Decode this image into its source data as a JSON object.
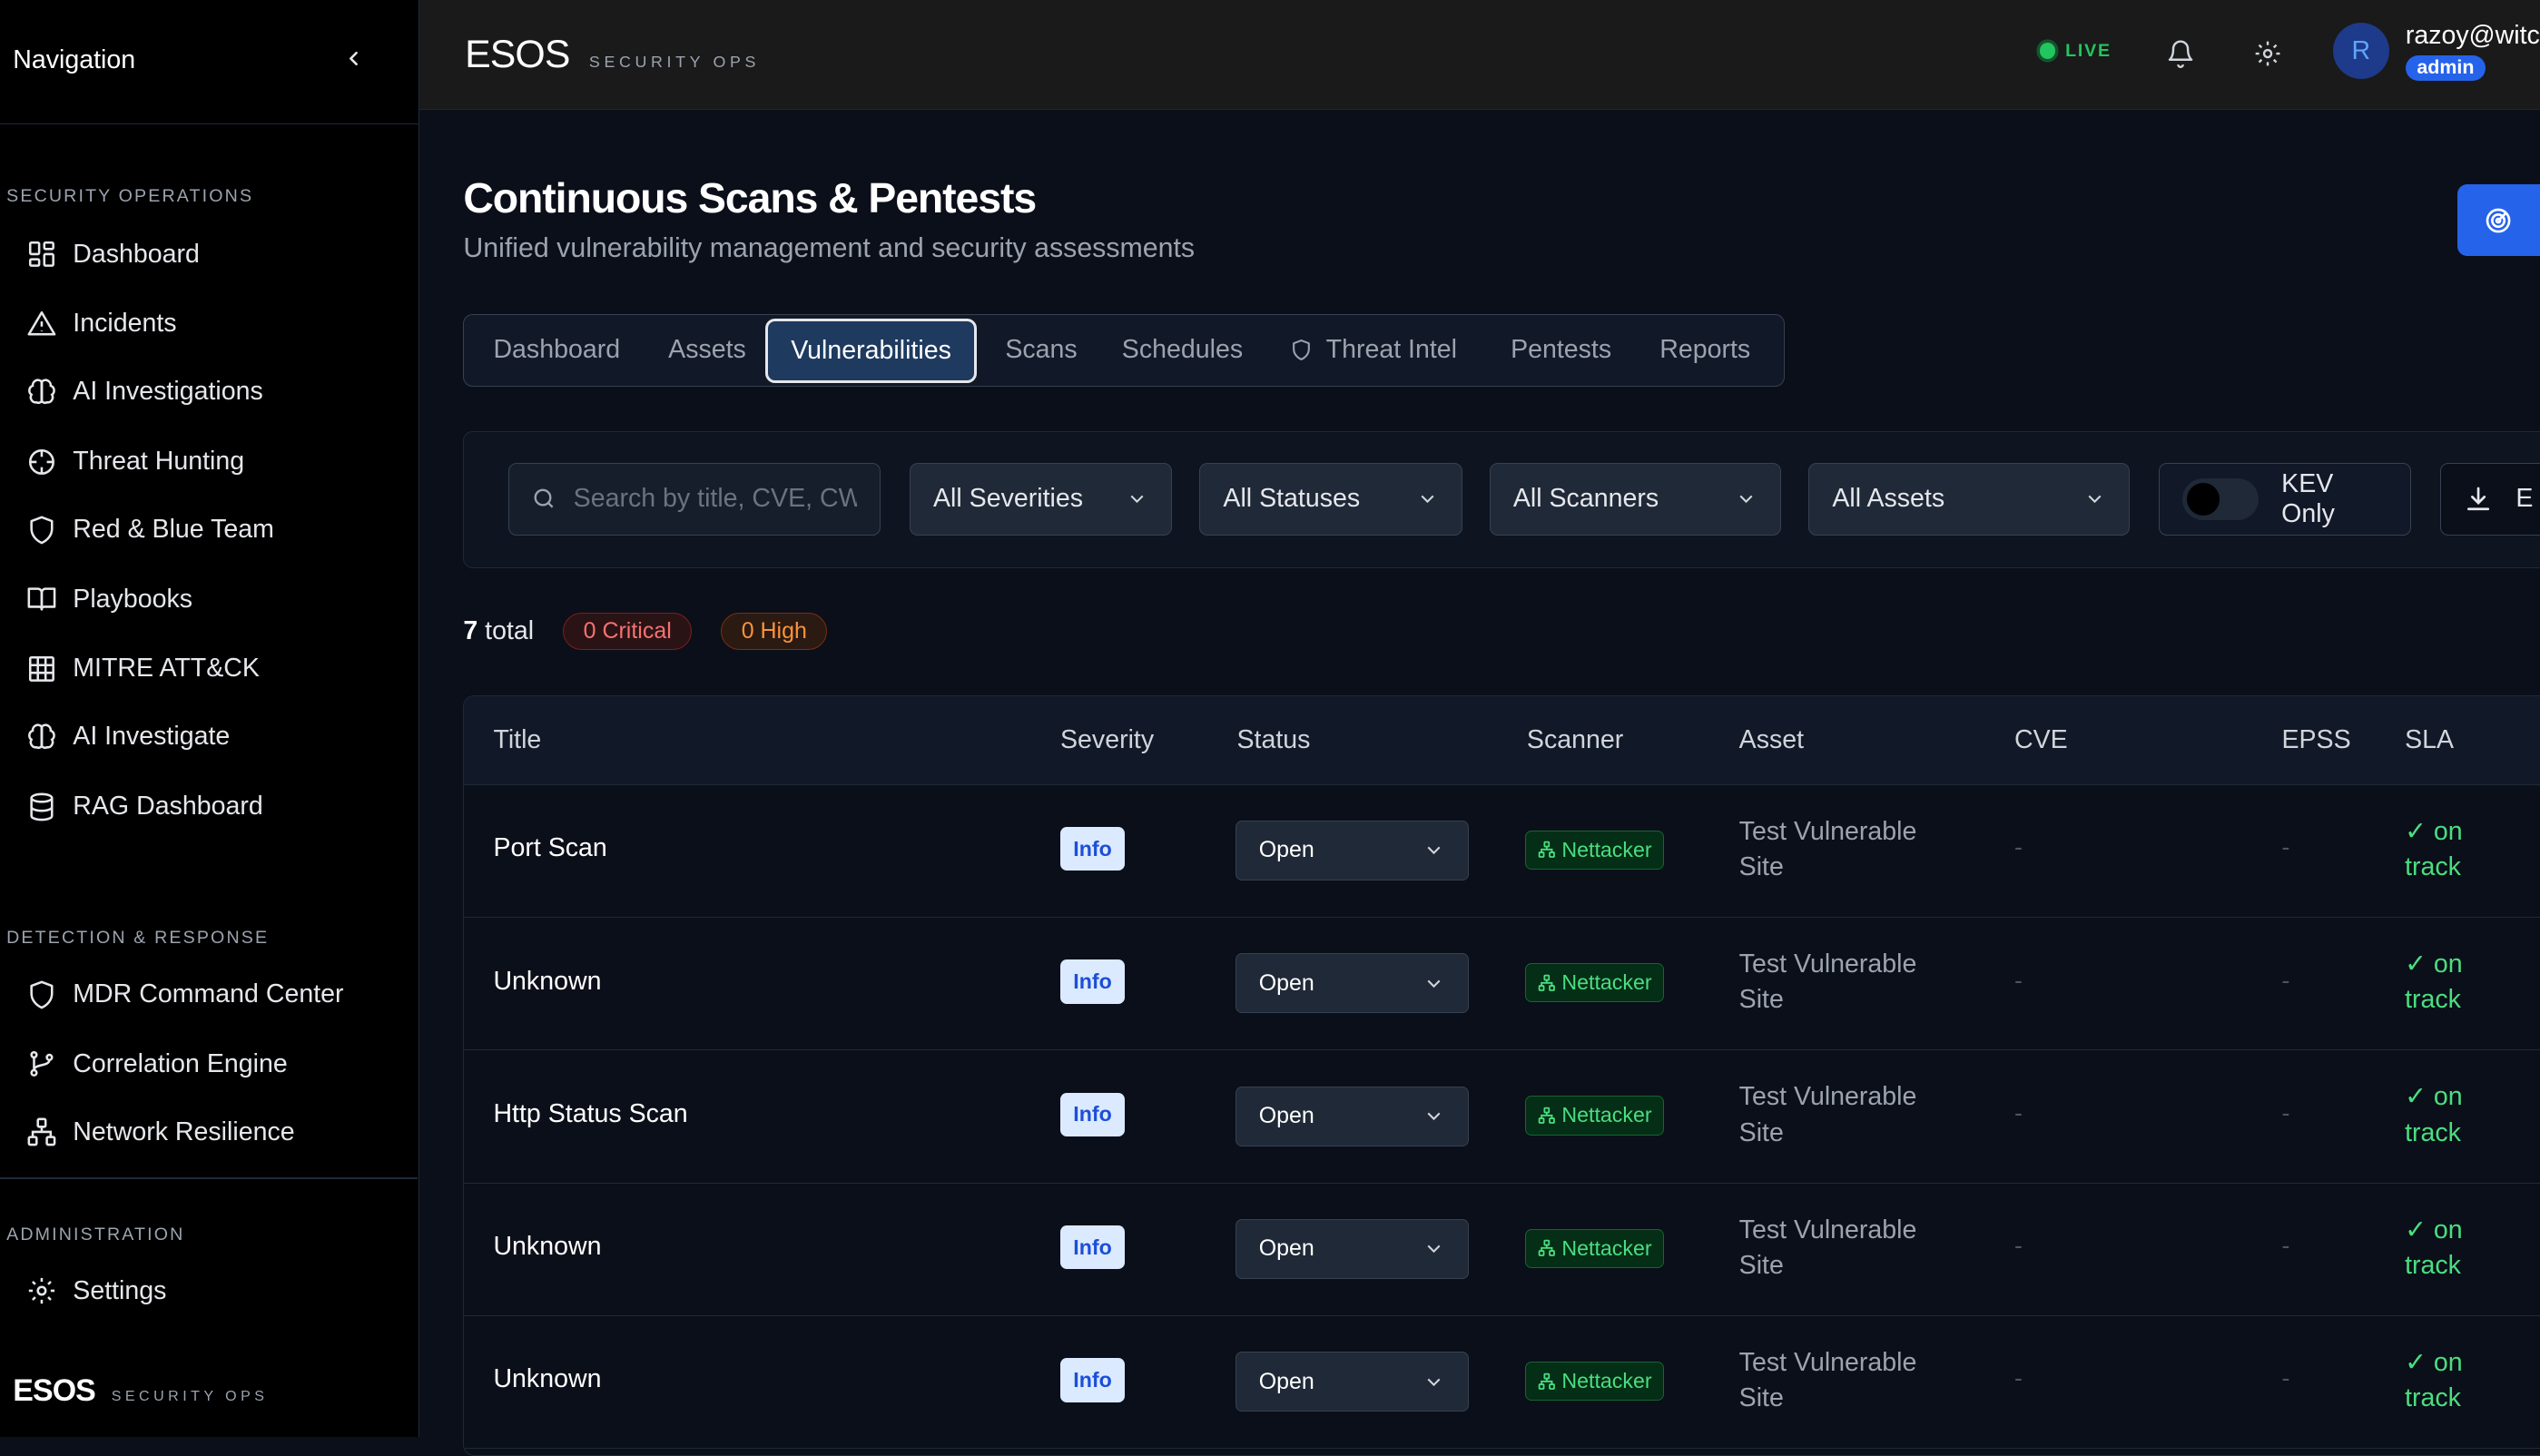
{
  "sidebar": {
    "title": "Navigation",
    "sections": [
      {
        "label": "SECURITY OPERATIONS"
      },
      {
        "label": "DETECTION & RESPONSE"
      },
      {
        "label": "ADMINISTRATION"
      }
    ],
    "items": [
      {
        "label": "Dashboard",
        "icon": "dashboard-icon"
      },
      {
        "label": "Incidents",
        "icon": "alert-triangle-icon"
      },
      {
        "label": "AI Investigations",
        "icon": "brain-icon"
      },
      {
        "label": "Threat Hunting",
        "icon": "crosshair-icon"
      },
      {
        "label": "Red & Blue Team",
        "icon": "shield-icon"
      },
      {
        "label": "Playbooks",
        "icon": "book-icon"
      },
      {
        "label": "MITRE ATT&CK",
        "icon": "grid-icon"
      },
      {
        "label": "AI Investigate",
        "icon": "brain-icon"
      },
      {
        "label": "RAG Dashboard",
        "icon": "database-icon"
      },
      {
        "label": "MDR Command Center",
        "icon": "shield-icon"
      },
      {
        "label": "Correlation Engine",
        "icon": "git-branch-icon"
      },
      {
        "label": "Network Resilience",
        "icon": "network-icon"
      },
      {
        "label": "Settings",
        "icon": "gear-icon"
      }
    ],
    "brand": {
      "name": "ESOS",
      "tagline": "SECURITY OPS"
    }
  },
  "topbar": {
    "brand": {
      "name": "ESOS",
      "tagline": "SECURITY OPS"
    },
    "live_label": "LIVE",
    "avatar_initial": "R",
    "user_email": "razoy@witc",
    "role": "admin"
  },
  "page": {
    "title": "Continuous Scans & Pentests",
    "subtitle": "Unified vulnerability management and security assessments"
  },
  "tabs": [
    {
      "label": "Dashboard"
    },
    {
      "label": "Assets"
    },
    {
      "label": "Vulnerabilities",
      "active": true
    },
    {
      "label": "Scans"
    },
    {
      "label": "Schedules"
    },
    {
      "label": "Threat Intel",
      "icon": "shield-icon"
    },
    {
      "label": "Pentests"
    },
    {
      "label": "Reports"
    }
  ],
  "filters": {
    "search_placeholder": "Search by title, CVE, CWE...",
    "severity": "All Severities",
    "status": "All Statuses",
    "scanner": "All Scanners",
    "assets": "All Assets",
    "kev_label": "KEV Only",
    "export_label": "E"
  },
  "summary": {
    "total": "7",
    "total_suffix": "total",
    "critical": "0 Critical",
    "high": "0 High"
  },
  "table": {
    "columns": [
      "Title",
      "Severity",
      "Status",
      "Scanner",
      "Asset",
      "CVE",
      "EPSS",
      "SLA"
    ],
    "rows": [
      {
        "title": "Port Scan",
        "severity": "Info",
        "status": "Open",
        "scanner": "Nettacker",
        "asset": "Test Vulnerable Site",
        "cve": "-",
        "epss": "-",
        "sla": "✓ on track"
      },
      {
        "title": "Unknown",
        "severity": "Info",
        "status": "Open",
        "scanner": "Nettacker",
        "asset": "Test Vulnerable Site",
        "cve": "-",
        "epss": "-",
        "sla": "✓ on track"
      },
      {
        "title": "Http Status Scan",
        "severity": "Info",
        "status": "Open",
        "scanner": "Nettacker",
        "asset": "Test Vulnerable Site",
        "cve": "-",
        "epss": "-",
        "sla": "✓ on track"
      },
      {
        "title": "Unknown",
        "severity": "Info",
        "status": "Open",
        "scanner": "Nettacker",
        "asset": "Test Vulnerable Site",
        "cve": "-",
        "epss": "-",
        "sla": "✓ on track"
      },
      {
        "title": "Unknown",
        "severity": "Info",
        "status": "Open",
        "scanner": "Nettacker",
        "asset": "Test Vulnerable Site",
        "cve": "-",
        "epss": "-",
        "sla": "✓ on track"
      }
    ]
  },
  "colors": {
    "accent": "#2563eb",
    "success": "#4ade80",
    "critical": "#f87171",
    "high": "#fb923c",
    "background": "#0b0f19"
  }
}
